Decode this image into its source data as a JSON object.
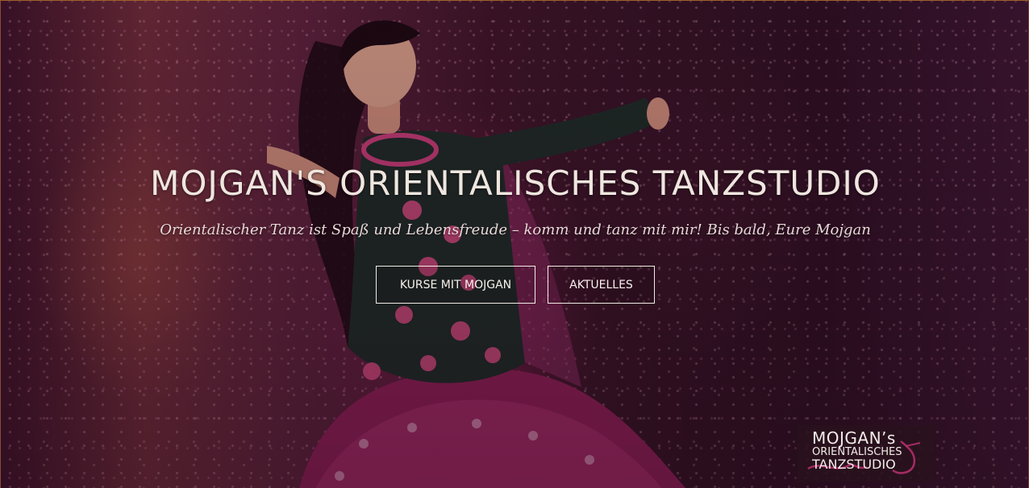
{
  "hero": {
    "title": "MOJGAN'S ORIENTALISCHES TANZSTUDIO",
    "subtitle": "Orientalischer Tanz ist Spaß und Lebensfreude –  komm und tanz mit mir! Bis bald, Eure Mojgan",
    "buttons": [
      {
        "label": "KURSE MIT MOJGAN"
      },
      {
        "label": "AKTUELLES"
      }
    ]
  },
  "logo": {
    "line1": "MOJGAN’s",
    "line2": "ORIENTALISCHES",
    "line3": "TANZSTUDIO"
  },
  "colors": {
    "text": "#efe6df",
    "button_border": "#f2ece6",
    "background": "#3c1427",
    "accent": "#b8306e"
  }
}
